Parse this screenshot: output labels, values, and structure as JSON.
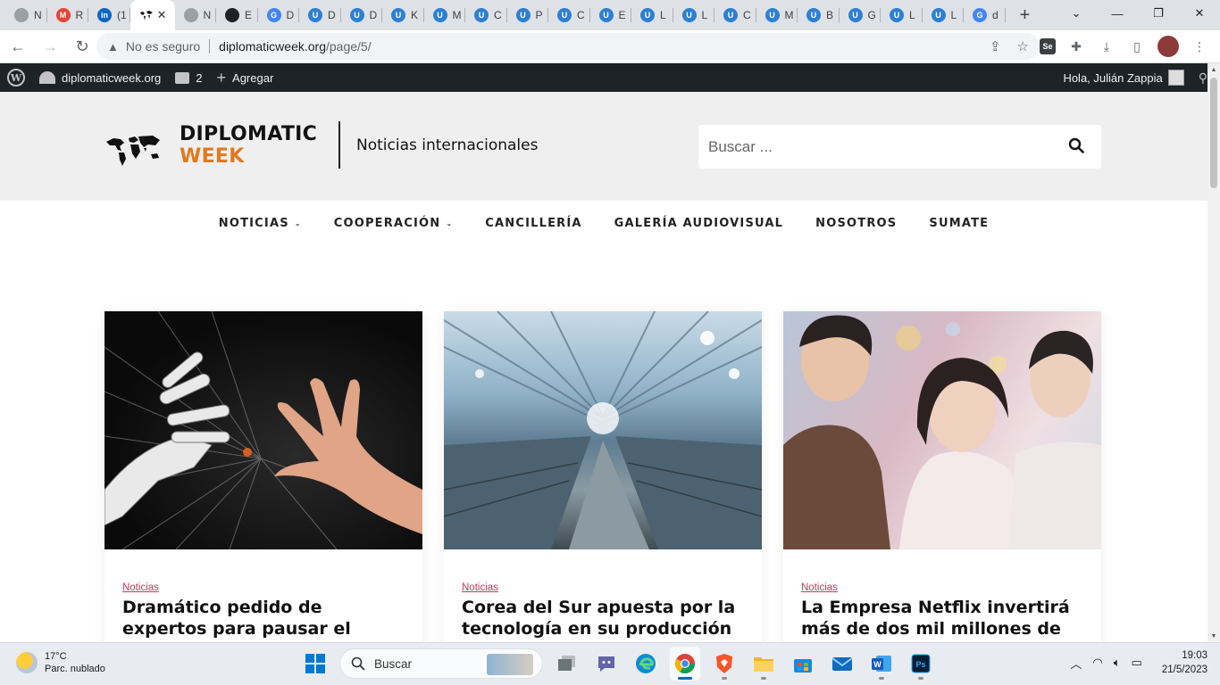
{
  "browser": {
    "tabs": [
      {
        "label": "N",
        "color": "#9aa0a6",
        "glyph": ""
      },
      {
        "label": "R",
        "color": "#ea4335",
        "glyph": "M"
      },
      {
        "label": "(1",
        "color": "#0a66c2",
        "glyph": "in"
      },
      {
        "label": "",
        "color": "#111111",
        "glyph": "",
        "active": true
      },
      {
        "label": "N",
        "color": "#9aa0a6",
        "glyph": ""
      },
      {
        "label": "E",
        "color": "#202124",
        "glyph": ""
      },
      {
        "label": "D",
        "color": "#4285f4",
        "glyph": "G"
      },
      {
        "label": "D",
        "color": "#2d7fd3",
        "glyph": "U"
      },
      {
        "label": "D",
        "color": "#2d7fd3",
        "glyph": "U"
      },
      {
        "label": "K",
        "color": "#2d7fd3",
        "glyph": "U"
      },
      {
        "label": "M",
        "color": "#2d7fd3",
        "glyph": "U"
      },
      {
        "label": "C",
        "color": "#2d7fd3",
        "glyph": "U"
      },
      {
        "label": "P",
        "color": "#2d7fd3",
        "glyph": "U"
      },
      {
        "label": "C",
        "color": "#2d7fd3",
        "glyph": "U"
      },
      {
        "label": "E",
        "color": "#2d7fd3",
        "glyph": "U"
      },
      {
        "label": "L",
        "color": "#2d7fd3",
        "glyph": "U"
      },
      {
        "label": "L",
        "color": "#2d7fd3",
        "glyph": "U"
      },
      {
        "label": "C",
        "color": "#2d7fd3",
        "glyph": "U"
      },
      {
        "label": "M",
        "color": "#2d7fd3",
        "glyph": "U"
      },
      {
        "label": "B",
        "color": "#2d7fd3",
        "glyph": "U"
      },
      {
        "label": "G",
        "color": "#2d7fd3",
        "glyph": "U"
      },
      {
        "label": "L",
        "color": "#2d7fd3",
        "glyph": "U"
      },
      {
        "label": "L",
        "color": "#2d7fd3",
        "glyph": "U"
      },
      {
        "label": "d",
        "color": "#4285f4",
        "glyph": "G"
      }
    ],
    "insecure_label": "No es seguro",
    "url_host": "diplomaticweek.org",
    "url_path": "/page/5/"
  },
  "adminbar": {
    "site_name": "diplomaticweek.org",
    "comments_count": "2",
    "add_label": "Agregar",
    "greeting": "Hola, Julián Zappia"
  },
  "site": {
    "logo_line1": "DIPLOMATIC",
    "logo_line2": "WEEK",
    "tagline": "Noticias internacionales",
    "search_placeholder": "Buscar ...",
    "nav": [
      {
        "label": "NOTICIAS",
        "has_submenu": true
      },
      {
        "label": "COOPERACIÓN",
        "has_submenu": true
      },
      {
        "label": "CANCILLERÍA",
        "has_submenu": false
      },
      {
        "label": "GALERÍA AUDIOVISUAL",
        "has_submenu": false
      },
      {
        "label": "NOSOTROS",
        "has_submenu": false
      },
      {
        "label": "SUMATE",
        "has_submenu": false
      }
    ],
    "posts": [
      {
        "category": "Noticias",
        "title": "Dramático pedido de expertos para pausar el desarrollo de la"
      },
      {
        "category": "Noticias",
        "title": "Corea del Sur apuesta por la tecnología en su producción"
      },
      {
        "category": "Noticias",
        "title": "La Empresa Netflix invertirá más de dos mil millones de"
      }
    ]
  },
  "taskbar": {
    "temperature": "17°C",
    "weather": "Parc. nublado",
    "search_label": "Buscar",
    "time": "19:03",
    "date": "21/5/2023"
  },
  "colors": {
    "accent_orange": "#e07a1f",
    "category_red": "#d4335b",
    "adminbar_bg": "#1d2327"
  }
}
